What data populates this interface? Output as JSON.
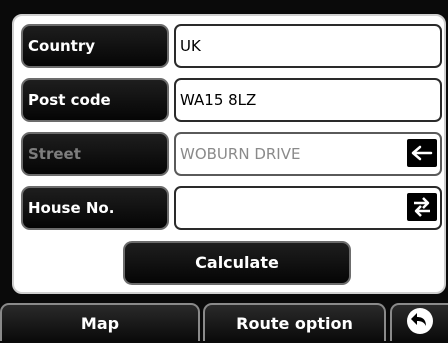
{
  "form": {
    "country": {
      "label": "Country",
      "value": "UK"
    },
    "postcode": {
      "label": "Post code",
      "value": "WA15 8LZ"
    },
    "street": {
      "label": "Street",
      "value": "WOBURN DRIVE",
      "icon": "backspace-arrow-icon"
    },
    "house": {
      "label": "House No.",
      "value": "",
      "icon": "swap-arrows-icon"
    }
  },
  "calculate_label": "Calculate",
  "nav": {
    "map_label": "Map",
    "route_label": "Route option",
    "back_icon": "back-arrow-icon"
  },
  "colors": {
    "background": "#0a0a0a",
    "panel": "#ffffff",
    "button": "#0a0a0a",
    "disabled_text": "#7d7d7d"
  }
}
